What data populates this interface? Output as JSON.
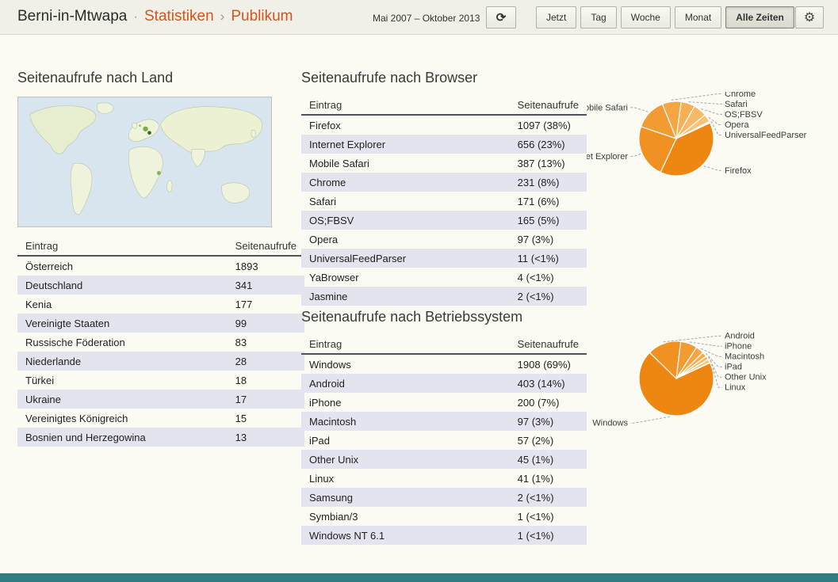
{
  "header": {
    "title": "Berni-in-Mtwapa",
    "sep_dot": "·",
    "nav_statistiken": "Statistiken",
    "sep_chevron": "›",
    "nav_publikum": "Publikum",
    "date_range": "Mai 2007 – Oktober 2013",
    "refresh_icon": "⟳",
    "gear_icon": "⚙",
    "buttons": [
      "Jetzt",
      "Tag",
      "Woche",
      "Monat",
      "Alle Zeiten"
    ],
    "active_button": "Alle Zeiten"
  },
  "sections": {
    "country": {
      "title": "Seitenaufrufe nach Land",
      "col_entry": "Eintrag",
      "col_views": "Seitenaufrufe",
      "rows": [
        {
          "label": "Österreich",
          "views": "1893"
        },
        {
          "label": "Deutschland",
          "views": "341"
        },
        {
          "label": "Kenia",
          "views": "177"
        },
        {
          "label": "Vereinigte Staaten",
          "views": "99"
        },
        {
          "label": "Russische Föderation",
          "views": "83"
        },
        {
          "label": "Niederlande",
          "views": "28"
        },
        {
          "label": "Türkei",
          "views": "18"
        },
        {
          "label": "Ukraine",
          "views": "17"
        },
        {
          "label": "Vereinigtes Königreich",
          "views": "15"
        },
        {
          "label": "Bosnien und Herzegowina",
          "views": "13"
        }
      ]
    },
    "browser": {
      "title": "Seitenaufrufe nach Browser",
      "col_entry": "Eintrag",
      "col_views": "Seitenaufrufe",
      "rows": [
        {
          "label": "Firefox",
          "views": "1097 (38%)"
        },
        {
          "label": "Internet Explorer",
          "views": "656 (23%)"
        },
        {
          "label": "Mobile Safari",
          "views": "387 (13%)"
        },
        {
          "label": "Chrome",
          "views": "231 (8%)"
        },
        {
          "label": "Safari",
          "views": "171 (6%)"
        },
        {
          "label": "OS;FBSV",
          "views": "165 (5%)"
        },
        {
          "label": "Opera",
          "views": "97 (3%)"
        },
        {
          "label": "UniversalFeedParser",
          "views": "11 (<1%)"
        },
        {
          "label": "YaBrowser",
          "views": "4 (<1%)"
        },
        {
          "label": "Jasmine",
          "views": "2 (<1%)"
        }
      ]
    },
    "os": {
      "title": "Seitenaufrufe nach Betriebssystem",
      "col_entry": "Eintrag",
      "col_views": "Seitenaufrufe",
      "rows": [
        {
          "label": "Windows",
          "views": "1908 (69%)"
        },
        {
          "label": "Android",
          "views": "403 (14%)"
        },
        {
          "label": "iPhone",
          "views": "200 (7%)"
        },
        {
          "label": "Macintosh",
          "views": "97 (3%)"
        },
        {
          "label": "iPad",
          "views": "57 (2%)"
        },
        {
          "label": "Other Unix",
          "views": "45 (1%)"
        },
        {
          "label": "Linux",
          "views": "41 (1%)"
        },
        {
          "label": "Samsung",
          "views": "2 (<1%)"
        },
        {
          "label": "Symbian/3",
          "views": "1 (<1%)"
        },
        {
          "label": "Windows NT 6.1",
          "views": "1 (<1%)"
        }
      ]
    }
  },
  "chart_data": [
    {
      "type": "pie",
      "title": "Seitenaufrufe nach Browser",
      "start_angle": 65,
      "legend_position": "outside-labels",
      "palette": [
        "#ee8711",
        "#f09122",
        "#f29b33",
        "#f4a544",
        "#f6af55",
        "#f7b966",
        "#f9c277",
        "#fbcc88",
        "#fcd699",
        "#fde0aa"
      ],
      "entries": [
        {
          "label": "Firefox",
          "value": 1097,
          "pct": "38%",
          "side": "right"
        },
        {
          "label": "Internet Explorer",
          "value": 656,
          "pct": "23%",
          "side": "left"
        },
        {
          "label": "Mobile Safari",
          "value": 387,
          "pct": "13%",
          "side": "left"
        },
        {
          "label": "Chrome",
          "value": 231,
          "pct": "8%",
          "side": "right"
        },
        {
          "label": "Safari",
          "value": 171,
          "pct": "6%",
          "side": "right"
        },
        {
          "label": "OS;FBSV",
          "value": 165,
          "pct": "5%",
          "side": "right"
        },
        {
          "label": "Opera",
          "value": 97,
          "pct": "3%",
          "side": "right"
        },
        {
          "label": "UniversalFeedParser",
          "value": 11,
          "pct": "<1%",
          "side": "right"
        },
        {
          "label": "YaBrowser",
          "value": 4,
          "pct": "<1%"
        },
        {
          "label": "Jasmine",
          "value": 2,
          "pct": "<1%"
        }
      ]
    },
    {
      "type": "pie",
      "title": "Seitenaufrufe nach Betriebssystem",
      "start_angle": 65,
      "legend_position": "outside-labels",
      "palette": [
        "#ee8711",
        "#f09122",
        "#f29b33",
        "#f4a544",
        "#f6af55",
        "#f7b966",
        "#f9c277",
        "#fbcc88",
        "#fcd699",
        "#fde0aa"
      ],
      "entries": [
        {
          "label": "Windows",
          "value": 1908,
          "pct": "69%",
          "side": "left"
        },
        {
          "label": "Android",
          "value": 403,
          "pct": "14%",
          "side": "right"
        },
        {
          "label": "iPhone",
          "value": 200,
          "pct": "7%",
          "side": "right"
        },
        {
          "label": "Macintosh",
          "value": 97,
          "pct": "3%",
          "side": "right"
        },
        {
          "label": "iPad",
          "value": 57,
          "pct": "2%",
          "side": "right"
        },
        {
          "label": "Other Unix",
          "value": 45,
          "pct": "1%",
          "side": "right"
        },
        {
          "label": "Linux",
          "value": 41,
          "pct": "1%",
          "side": "right"
        },
        {
          "label": "Samsung",
          "value": 2,
          "pct": "<1%"
        },
        {
          "label": "Symbian/3",
          "value": 1,
          "pct": "<1%"
        },
        {
          "label": "Windows NT 6.1",
          "value": 1,
          "pct": "<1%"
        }
      ]
    }
  ]
}
